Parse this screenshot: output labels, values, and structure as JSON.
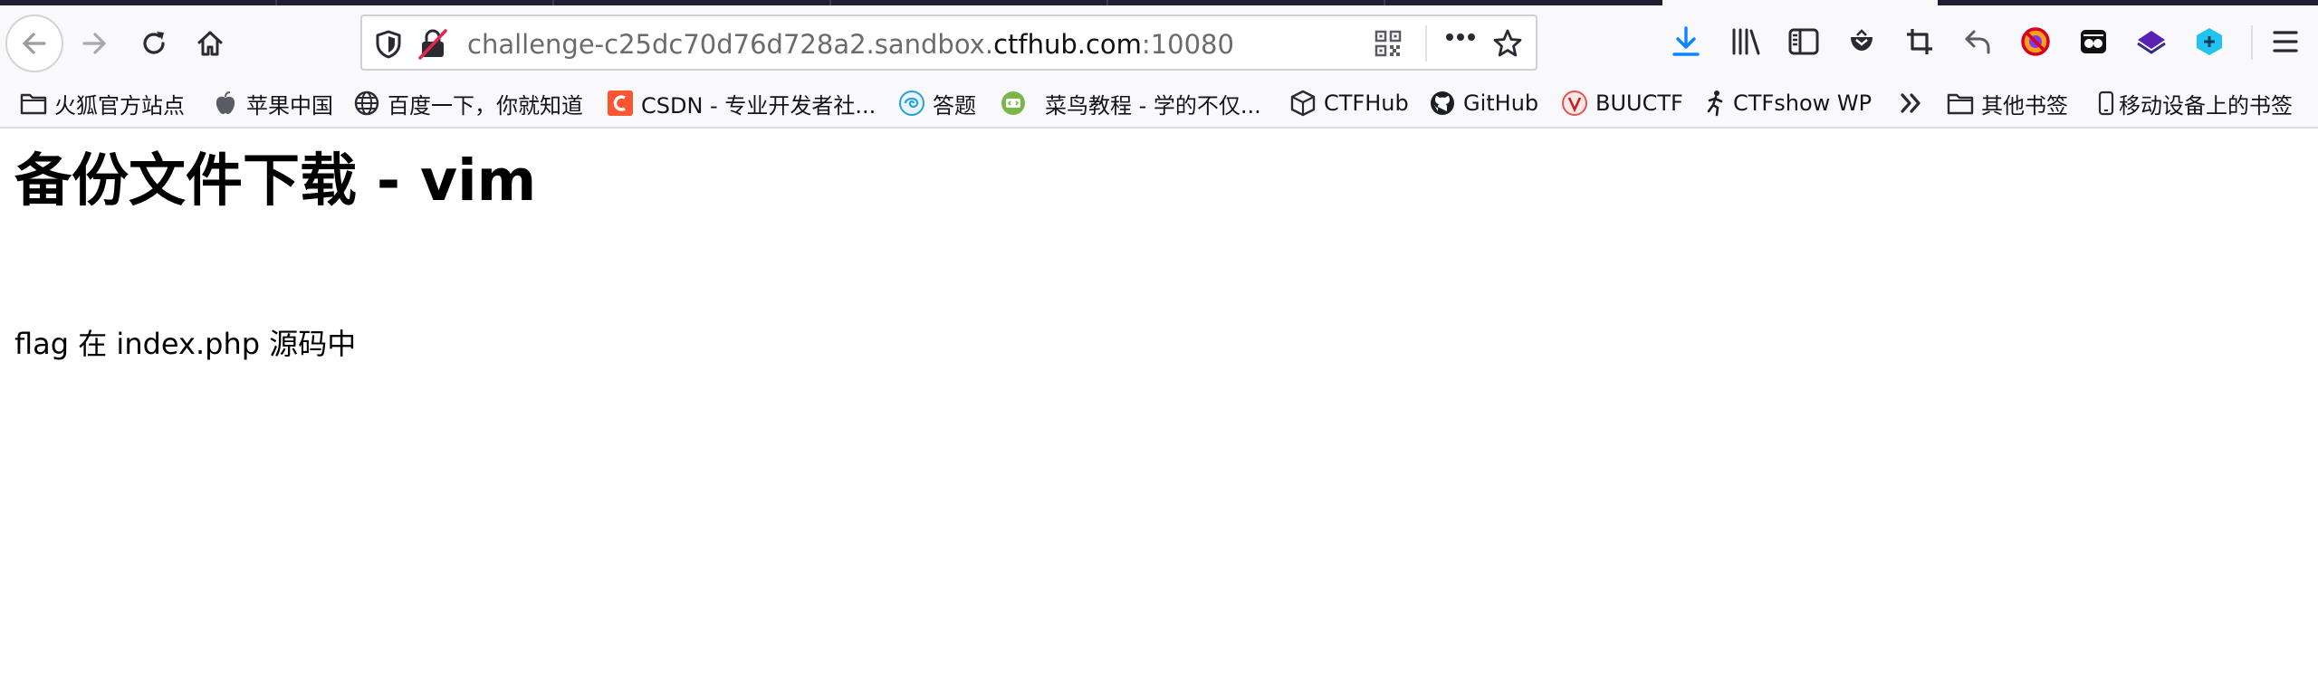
{
  "browser": {
    "url": {
      "prefix": "challenge-c25dc70d76d728a2.sandbox.",
      "host": "ctfhub.com",
      "suffix": ":10080"
    },
    "toolbar_icons": [
      "download-icon",
      "library-icon",
      "sidebar-icon",
      "pocket-icon",
      "screenshot-crop-icon",
      "undo-arrow-icon",
      "blocked-extension-icon",
      "extension-icon",
      "layers-extension-icon",
      "hexagon-extension-icon",
      "menu-icon"
    ],
    "accent_color": "#0a84ff"
  },
  "bookmarks": {
    "items": [
      {
        "label": "火狐官方站点",
        "icon": "folder-icon"
      },
      {
        "label": "苹果中国",
        "icon": "apple-icon"
      },
      {
        "label": "百度一下，你就知道",
        "icon": "globe-icon"
      },
      {
        "label": "CSDN - 专业开发者社...",
        "icon": "csdn-icon"
      },
      {
        "label": "答题",
        "icon": "swirl-icon"
      },
      {
        "label": "菜鸟教程 - 学的不仅...",
        "icon": "runoob-icon"
      },
      {
        "label": "CTFHub",
        "icon": "cube-icon"
      },
      {
        "label": "GitHub",
        "icon": "github-icon"
      },
      {
        "label": "BUUCTF",
        "icon": "buuctf-icon"
      },
      {
        "label": "CTFshow WP",
        "icon": "runner-icon"
      }
    ],
    "overflow_icon": "chevron-double-right-icon",
    "other_bookmarks": "其他书签",
    "mobile_bookmarks": "移动设备上的书签"
  },
  "page": {
    "heading": "备份文件下载 - vim",
    "body_text": "flag 在 index.php 源码中"
  }
}
